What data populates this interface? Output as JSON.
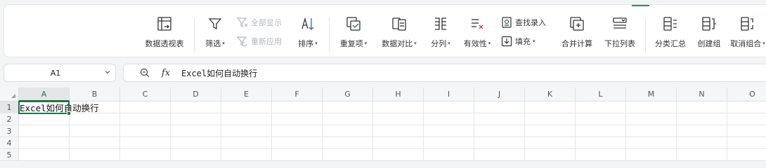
{
  "ribbon": {
    "pivot_table": "数据透视表",
    "filter": "筛选",
    "show_all": "全部显示",
    "reapply": "重新应用",
    "sort": "排序",
    "duplicates": "重复项",
    "data_compare": "数据对比",
    "split_column": "分列",
    "validity": "有效性",
    "find_entry": "查找录入",
    "fill": "填充",
    "consolidate": "合并计算",
    "dropdown_list": "下拉列表",
    "subtotal": "分类汇总",
    "create_group": "创建组",
    "ungroup": "取消组合"
  },
  "formula_bar": {
    "cell_ref": "A1",
    "fx_label": "fx",
    "value": "Excel如何自动换行"
  },
  "grid": {
    "columns": [
      "A",
      "B",
      "C",
      "D",
      "E",
      "F",
      "G",
      "H",
      "I",
      "J",
      "K",
      "L",
      "M",
      "N",
      "O"
    ],
    "rows": [
      "1",
      "2",
      "3",
      "4",
      "5"
    ],
    "cells": {
      "A1": "Excel如何自动换行"
    },
    "selected_cell": "A1"
  },
  "colors": {
    "accent": "#217346",
    "header_bg": "#f5f6f7",
    "gridline": "#e4e6e8"
  },
  "icons": {
    "pivot_table": "pivot-table-icon",
    "filter": "funnel-icon",
    "sort": "sort-icon",
    "duplicates": "duplicates-icon",
    "data_compare": "compare-icon",
    "split_column": "split-column-icon",
    "validity": "validity-icon",
    "find_entry": "find-entry-icon",
    "fill": "fill-icon",
    "consolidate": "consolidate-icon",
    "dropdown_list": "dropdown-list-icon",
    "subtotal": "subtotal-icon",
    "create_group": "group-icon",
    "ungroup": "ungroup-icon",
    "zoom": "zoom-icon"
  }
}
